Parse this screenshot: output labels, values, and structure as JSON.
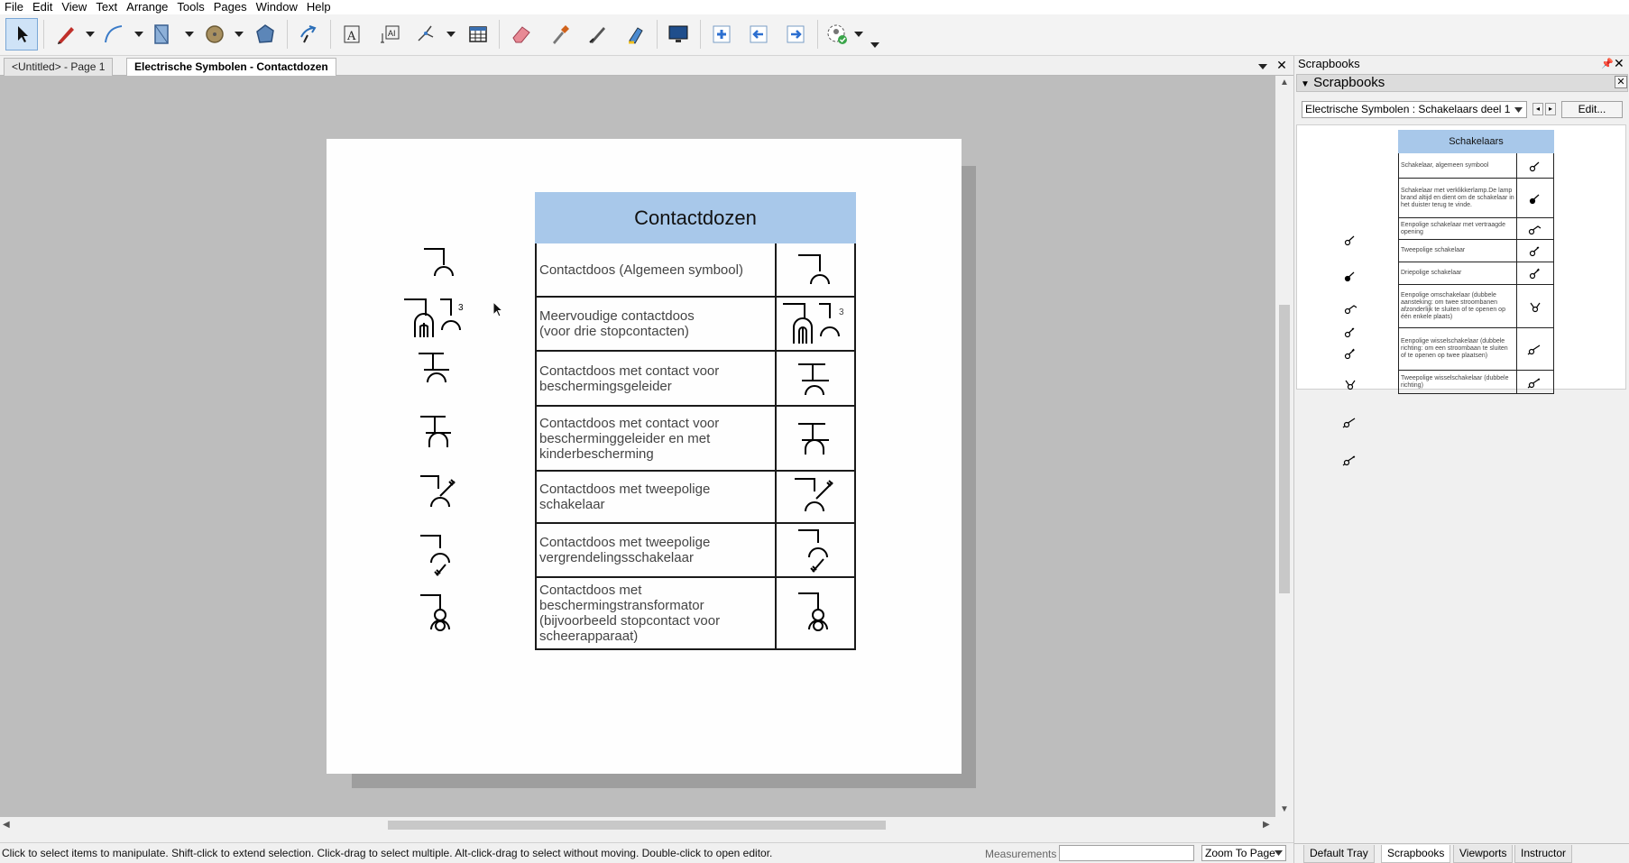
{
  "menu": [
    "File",
    "Edit",
    "View",
    "Text",
    "Arrange",
    "Tools",
    "Pages",
    "Window",
    "Help"
  ],
  "toolbar": {
    "tools": [
      "select-tool",
      "pen-tool",
      "line-tool",
      "rectangle-tool",
      "circle-tool",
      "polygon-tool",
      "pan-tool",
      "text-tool",
      "multiline-text-tool",
      "connector-tool",
      "table-tool",
      "eraser-tool",
      "eyedropper-tool",
      "knife-tool",
      "highlighter-tool",
      "presentation-tool",
      "add-page-tool",
      "prev-page-tool",
      "next-page-tool",
      "instructor-tool"
    ]
  },
  "tabs": [
    {
      "label": "<Untitled> - Page 1",
      "active": false
    },
    {
      "label": "Electrische Symbolen - Contactdozen",
      "active": true
    }
  ],
  "page": {
    "table_title": "Contactdozen",
    "rows": [
      "Contactdoos (Algemeen symbool)",
      "Meervoudige contactdoos\n (voor drie stopcontacten)",
      "Contactdoos met contact voor\nbeschermingsgeleider",
      "Contactdoos met contact voor\nbescherminggeleider en met\nkinderbescherming",
      "Contactdoos met tweepolige\nschakelaar",
      "Contactdoos met tweepolige\nvergrendelingsschakelaar",
      "Contactdoos met\nbeschermingstransformator\n(bijvoorbeeld stopcontact voor\nscheerapparaat)"
    ],
    "multi_count_label": "3"
  },
  "status": {
    "text": "Click to select items to manipulate. Shift-click to extend selection. Click-drag to select multiple. Alt-click-drag to select without moving. Double-click to open editor.",
    "measurements_label": "Measurements",
    "measurements_value": "",
    "zoom": "Zoom To Page"
  },
  "scrapbooks": {
    "panel_title": "Scrapbooks",
    "section_title": "Scrapbooks",
    "selected": "Electrische Symbolen : Schakelaars deel 1",
    "edit_label": "Edit...",
    "table_title": "Schakelaars",
    "rows": [
      "Schakelaar, algemeen symbool",
      "Schakelaar met verklikkerlamp.De lamp brand altijd en dient om de schakelaar in het duister terug te vinde.",
      "Eenpolige schakelaar met vertraagde opening",
      "Tweepolige schakelaar",
      "Driepolige schakelaar",
      "Eenpolige omschakelaar (dubbele aansteking: om twee stroombanen afzonderlijk te sluiten of te openen op één enkele plaats)",
      "Eenpolige wisselschakelaar (dubbele richting: om een stroombaan te sluiten of te openen op twee plaatsen)",
      "Tweepolige wisselschakelaar (dubbele richting)"
    ]
  },
  "panel_tabs": [
    "Default Tray",
    "Scrapbooks",
    "Viewports",
    "Instructor"
  ],
  "colors": {
    "table_header": "#a8c8ea",
    "canvas_bg": "#bdbdbd"
  }
}
